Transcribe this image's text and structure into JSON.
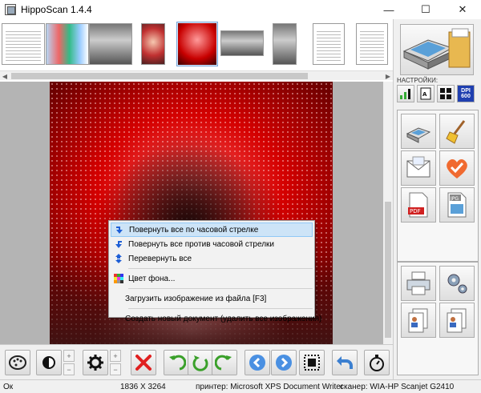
{
  "window": {
    "title": "HippoScan 1.4.4",
    "minimize": "—",
    "maximize": "☐",
    "close": "✕"
  },
  "context_menu": {
    "items": [
      {
        "label": "Повернуть все по часовой стрелке",
        "icon": "rotate-cw-icon"
      },
      {
        "label": "Повернуть все против часовой стрелки",
        "icon": "rotate-ccw-icon"
      },
      {
        "label": "Перевернуть все",
        "icon": "flip-icon"
      },
      {
        "label": "Цвет фона...",
        "icon": "color-grid-icon"
      },
      {
        "label": "Загрузить изображение из файла [F3]",
        "icon": ""
      },
      {
        "label": "Создать новый документ (удалить все изображения)",
        "icon": ""
      }
    ]
  },
  "right_panel": {
    "settings_label": "НАСТРОЙКИ:",
    "dpi_top": "DPI",
    "dpi_value": "600"
  },
  "toolbar": {
    "plus": "+",
    "minus": "−"
  },
  "status": {
    "state": "Ок",
    "dimensions": "1836 X 3264",
    "printer": "принтер:  Microsoft XPS Document Writer",
    "scanner": "сканер:  WIA-HP Scanjet G2410"
  },
  "colors": {
    "menu_highlight": "#cde4f7",
    "accent_blue": "#1f5fd6",
    "delete_red": "#e02020",
    "rotate_green": "#3aa02a"
  }
}
